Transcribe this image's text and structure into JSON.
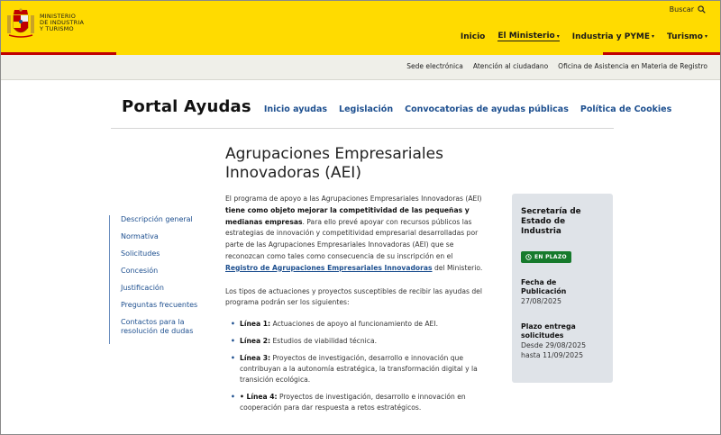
{
  "header": {
    "logo_lines": [
      "MINISTERIO",
      "DE INDUSTRIA",
      "Y TURISMO"
    ],
    "search_label": "Buscar",
    "nav": [
      {
        "label": "Inicio",
        "dropdown": false,
        "active": false
      },
      {
        "label": "El Ministerio",
        "dropdown": true,
        "active": true
      },
      {
        "label": "Industria y PYME",
        "dropdown": true,
        "active": false
      },
      {
        "label": "Turismo",
        "dropdown": true,
        "active": false
      }
    ],
    "colors": {
      "background": "#ffdb00",
      "accent": "#c00000"
    }
  },
  "subbar": {
    "links": [
      "Sede electrónica",
      "Atención al ciudadano",
      "Oficina de Asistencia en Materia de Registro"
    ]
  },
  "portal": {
    "title": "Portal Ayudas",
    "nav": [
      "Inicio ayudas",
      "Legislación",
      "Convocatorias de ayudas públicas",
      "Política de Cookies"
    ]
  },
  "sidenav": {
    "links": [
      "Descripción general",
      "Normativa",
      "Solicitudes",
      "Concesión",
      "Justificación",
      "Preguntas frecuentes",
      "Contactos para la resolución de dudas"
    ]
  },
  "main": {
    "title": "Agrupaciones Empresariales Innovadoras (AEI)",
    "intro_1": "El programa de apoyo a las Agrupaciones Empresariales Innovadoras (AEI) ",
    "intro_bold": "tiene como objeto mejorar la competitividad de las pequeñas y medianas empresas",
    "intro_2": ". Para ello prevé apoyar con recursos públicos las estrategias de innovación y competitividad empresarial desarrolladas por parte de las Agrupaciones Empresariales Innovadoras (AEI) que se reconozcan como tales como consecuencia de su inscripción en el ",
    "intro_link": "Registro de Agrupaciones Empresariales Innovadoras",
    "intro_3": " del Ministerio.",
    "types_intro": "Los tipos de actuaciones y proyectos susceptibles de recibir las ayudas del programa podrán ser los siguientes:",
    "lines": [
      {
        "label": "Línea 1:",
        "text": " Actuaciones de apoyo al funcionamiento de AEI."
      },
      {
        "label": "Línea 2:",
        "text": " Estudios de viabilidad técnica."
      },
      {
        "label": "Línea 3:",
        "text": " Proyectos de investigación, desarrollo e innovación que contribuyan a la autonomía estratégica, la transformación digital y la transición ecológica."
      },
      {
        "label": "• Línea 4:",
        "text": " Proyectos de investigación, desarrollo e innovación en cooperación para dar respuesta a retos estratégicos."
      }
    ]
  },
  "card": {
    "organization": "Secretaría de Estado de Industria",
    "status": "EN PLAZO",
    "status_color": "#167a2c",
    "pub_label": "Fecha de Publicación",
    "pub_date": "27/08/2025",
    "plazo_label": "Plazo entrega solicitudes",
    "plazo_from": "Desde 29/08/2025",
    "plazo_to": "hasta 11/09/2025"
  }
}
